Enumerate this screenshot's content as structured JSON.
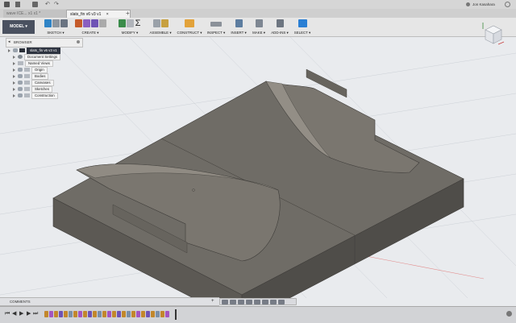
{
  "titlebar": {
    "user_name": "Jon Kasahara"
  },
  "tabs": [
    {
      "label": "wave ICE... x1 x1 *",
      "active": false
    },
    {
      "label": "slats_fin v6 v3 v1",
      "active": true
    }
  ],
  "toolbar": {
    "workspace": "MODEL",
    "groups": [
      {
        "label": "SKETCH ▾",
        "icon": "sketch-icon"
      },
      {
        "label": "CREATE ▾",
        "icon": "create-icon"
      },
      {
        "label": "MODIFY ▾",
        "icon": "modify-icon"
      },
      {
        "label": "ASSEMBLE ▾",
        "icon": "assemble-icon"
      },
      {
        "label": "CONSTRUCT ▾",
        "icon": "construct-icon"
      },
      {
        "label": "INSPECT ▾",
        "icon": "inspect-icon"
      },
      {
        "label": "INSERT ▾",
        "icon": "insert-icon"
      },
      {
        "label": "MAKE ▾",
        "icon": "make-icon"
      },
      {
        "label": "ADD-INS ▾",
        "icon": "addins-icon"
      },
      {
        "label": "SELECT ▾",
        "icon": "select-icon"
      }
    ]
  },
  "browser": {
    "title": "BROWSER",
    "root": "slats_fin v6 v3 v1",
    "items": [
      {
        "label": "Document Settings"
      },
      {
        "label": "Named Views"
      },
      {
        "label": "Origin"
      },
      {
        "label": "Bodies"
      },
      {
        "label": "Canvases"
      },
      {
        "label": "Sketches"
      },
      {
        "label": "Construction"
      }
    ]
  },
  "comments": {
    "label": "COMMENTS"
  },
  "colors": {
    "model_face_top": "#6f6c66",
    "model_face_side": "#5c5954",
    "model_face_front": "#4f4d49",
    "viewport_bg": "#e9ebee",
    "grid": "#c8ccd2",
    "active_tab": "#f2f2f2",
    "select_accent": "#2a7fd4"
  }
}
